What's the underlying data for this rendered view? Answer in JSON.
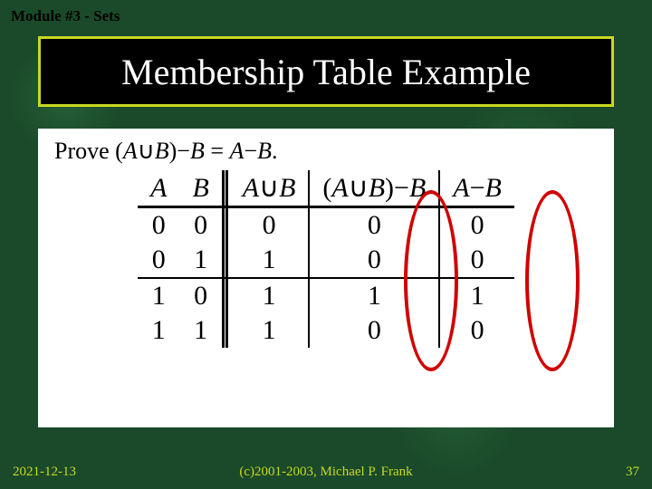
{
  "header": "Module #3 - Sets",
  "title": "Membership Table Example",
  "prove_prefix": "Prove (",
  "prove_A": "A",
  "prove_union": "∪",
  "prove_B1": "B",
  "prove_mid": ")−",
  "prove_B2": "B",
  "prove_eq": " = ",
  "prove_A2": "A",
  "prove_minus": "−",
  "prove_B3": "B",
  "prove_end": ".",
  "columns": {
    "c1": "A",
    "c2": "B",
    "c3_pre": "A",
    "c3_op": "∪",
    "c3_post": "B",
    "c4_pre": "(A",
    "c4_op": "∪",
    "c4_mid": "B)",
    "c4_op2": "−",
    "c4_post": "B",
    "c5_pre": "A",
    "c5_op": "−",
    "c5_post": "B"
  },
  "rows": [
    {
      "a": "0",
      "b": "0",
      "aub": "0",
      "aub_b": "0",
      "a_b": "0"
    },
    {
      "a": "0",
      "b": "1",
      "aub": "1",
      "aub_b": "0",
      "a_b": "0"
    },
    {
      "a": "1",
      "b": "0",
      "aub": "1",
      "aub_b": "1",
      "a_b": "1"
    },
    {
      "a": "1",
      "b": "1",
      "aub": "1",
      "aub_b": "0",
      "a_b": "0"
    }
  ],
  "footer": {
    "left": "2021-12-13",
    "center": "(c)2001-2003, Michael P. Frank",
    "right": "37"
  }
}
